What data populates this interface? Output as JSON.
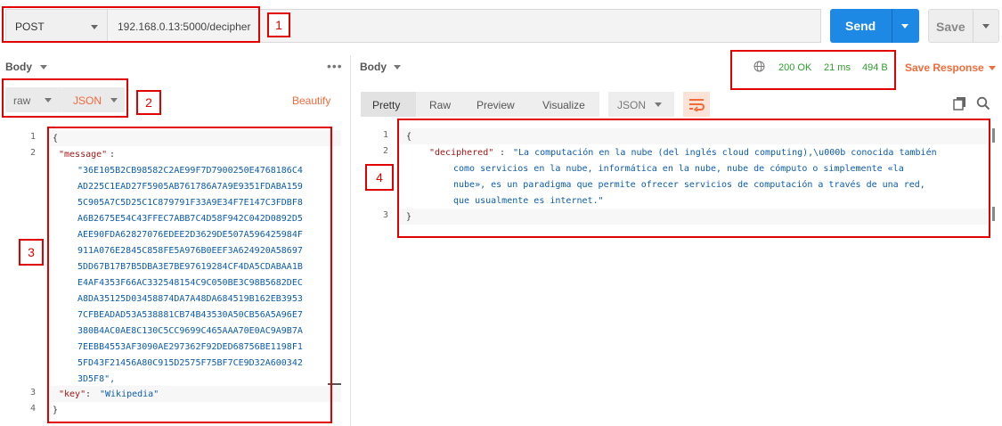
{
  "request": {
    "method": "POST",
    "url": "192.168.0.13:5000/decipher",
    "send_label": "Send",
    "save_label": "Save"
  },
  "request_body": {
    "title": "Body",
    "more_icon": "more-dots-icon",
    "mode": "raw",
    "format": "JSON",
    "beautify_label": "Beautify",
    "line_numbers": [
      "1",
      "2",
      "3",
      "4"
    ],
    "lines": {
      "open_brace": "{",
      "message_key": "\"message\"",
      "message_colon": ":",
      "message_value_lines": [
        "\"36E105B2CB98582C2AE99F7D7900250E4768186C4",
        "AD225C1EAD27F5905AB761786A7A9E9351FDABA159",
        "5C905A7C5D25C1C879791F33A9E34F7E147C3FDBF8",
        "A6B2675E54C43FFEC7ABB7C4D58F942C042D0892D5",
        "AEE90FDA62827076EDEE2D3629DE507A596425984F",
        "911A076E2845C858FE5A976B0EEF3A624920A58697",
        "5DD67B17B7B5DBA3E7BE97619284CF4DA5CDABAA1B",
        "E4AF4353F66AC332548154C9C050BE3C98B5682DEC",
        "A8DA35125D03458874DA7A48DA684519B162EB3953",
        "7CFBEADAD53A538881CB74B43530A50CB56A5A96E7",
        "380B4AC0AE8C130C5CC9699C465AAA70E0AC9A9B7A",
        "7EEBB4553AF3090AE297362F92DED68756BE1198F1",
        "5FD43F21456A80C915D2575F75BF7CE9D32A600342",
        "3D5F8\","
      ],
      "key_key": "\"key\"",
      "key_colon": ": ",
      "key_value": "\"Wikipedia\"",
      "close_brace": "}"
    }
  },
  "response": {
    "title": "Body",
    "globe_icon": "globe-icon",
    "status": "200 OK",
    "time": "21 ms",
    "size": "494 B",
    "save_response_label": "Save Response",
    "view_tabs": [
      "Pretty",
      "Raw",
      "Preview",
      "Visualize"
    ],
    "format": "JSON",
    "wrap_icon": "wrap-lines-icon",
    "copy_icon": "copy-icon",
    "search_icon": "search-icon",
    "line_numbers": [
      "1",
      "2",
      "3"
    ],
    "lines": {
      "open_brace": "{",
      "deciphered_key": "\"deciphered\"",
      "deciphered_colon": ": ",
      "deciphered_value_lines": [
        "\"La computación en la nube (del inglés cloud computing),\\u000b conocida también",
        "como servicios en la nube, informática en la nube, nube de cómputo o simplemente «la",
        "nube», es un paradigma que permite ofrecer servicios de computación a través de una red,",
        "que usualmente es internet.\""
      ],
      "close_brace": "}"
    }
  },
  "annotations": [
    "1",
    "2",
    "3",
    "4"
  ],
  "colors": {
    "accent": "#1e88e5",
    "orange": "#f26b3a",
    "status_green": "#2e9d2e",
    "annotation_red": "#e00000"
  }
}
